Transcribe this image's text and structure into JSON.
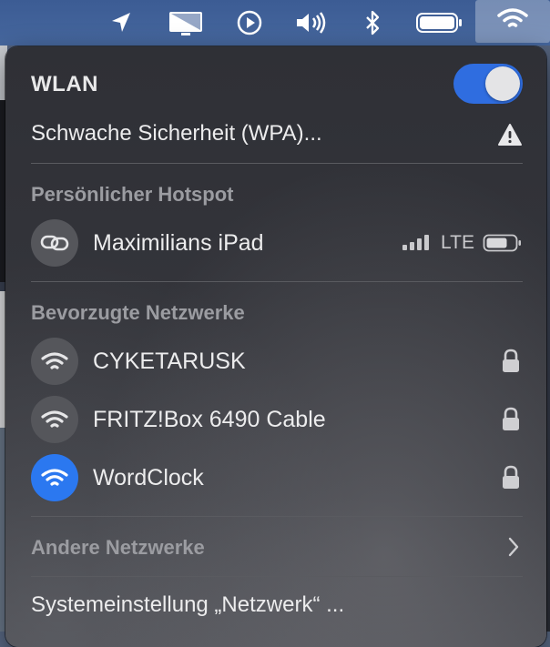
{
  "colors": {
    "accent": "#2f6de0",
    "panel_bg": "#323338",
    "text": "#ececed",
    "section_text": "#9b9ca1"
  },
  "menubar": {
    "icons": [
      "location-arrow-icon",
      "screen-mirroring-icon",
      "play-circle-icon",
      "volume-icon",
      "bluetooth-icon",
      "battery-icon",
      "wifi-icon"
    ]
  },
  "wlan": {
    "title": "WLAN",
    "enabled": true,
    "security_warning": "Schwache Sicherheit (WPA)..."
  },
  "hotspot": {
    "section_title": "Persönlicher Hotspot",
    "device": "Maximilians iPad",
    "network_type": "LTE",
    "signal_bars": 4
  },
  "preferred": {
    "section_title": "Bevorzugte Netzwerke",
    "networks": [
      {
        "name": "CYKETARUSK",
        "secured": true,
        "connected": false
      },
      {
        "name": "FRITZ!Box 6490 Cable",
        "secured": true,
        "connected": false
      },
      {
        "name": "WordClock",
        "secured": true,
        "connected": true
      }
    ]
  },
  "other_networks": {
    "label": "Andere Netzwerke"
  },
  "settings_link": {
    "label": "Systemeinstellung „Netzwerk“ ..."
  }
}
